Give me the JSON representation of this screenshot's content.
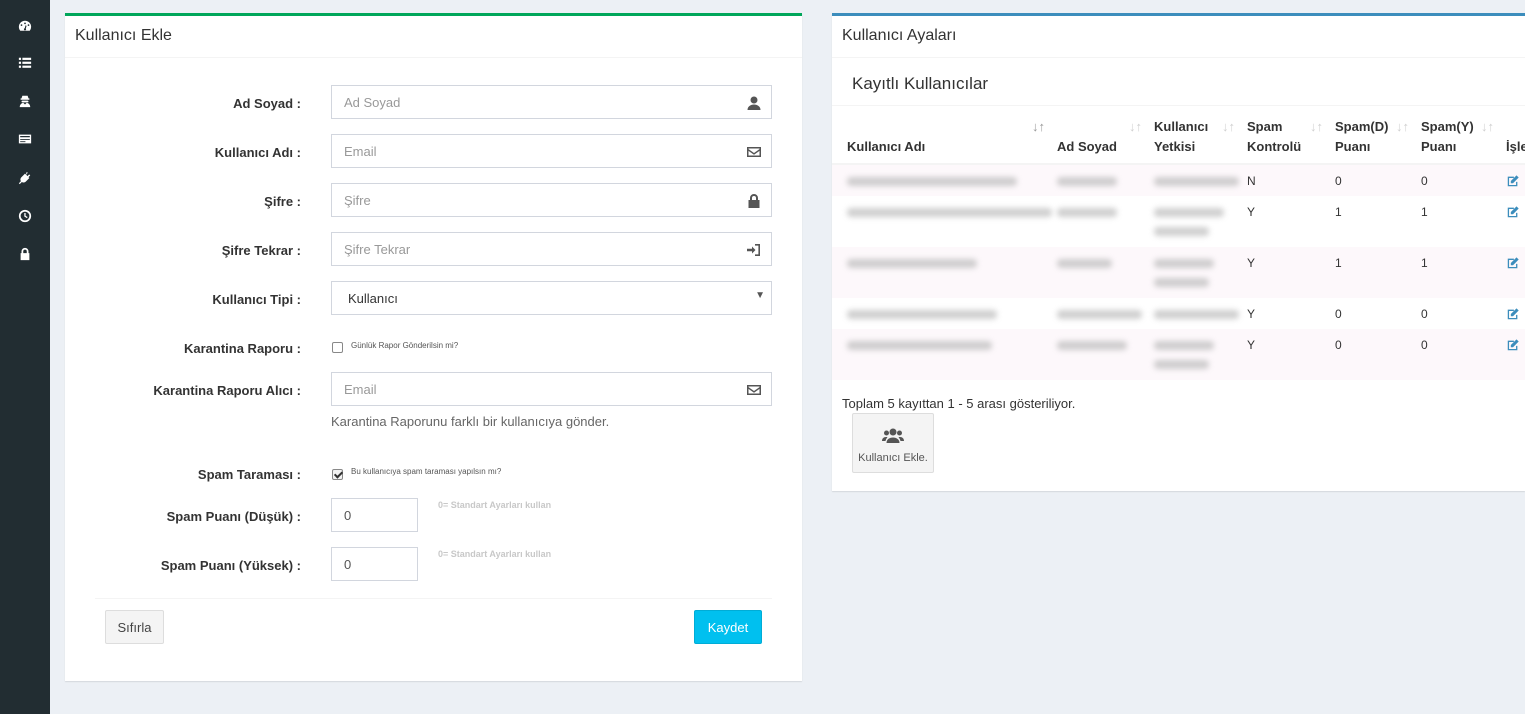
{
  "sidebar": {
    "icons": [
      "dashboard-icon",
      "list-icon",
      "user-secret-icon",
      "card-icon",
      "plug-icon",
      "clock-icon",
      "lock-icon"
    ]
  },
  "add_user": {
    "title": "Kullanıcı Ekle",
    "fields": {
      "name": {
        "label": "Ad Soyad :",
        "placeholder": "Ad Soyad",
        "icon": "user-icon"
      },
      "username": {
        "label": "Kullanıcı Adı :",
        "placeholder": "Email",
        "icon": "envelope-icon"
      },
      "password": {
        "label": "Şifre :",
        "placeholder": "Şifre",
        "icon": "lock-icon"
      },
      "password_repeat": {
        "label": "Şifre Tekrar :",
        "placeholder": "Şifre Tekrar",
        "icon": "sign-in-icon"
      },
      "user_type": {
        "label": "Kullanıcı Tipi :",
        "value": "Kullanıcı"
      },
      "quarantine_report": {
        "label": "Karantina Raporu :",
        "checkbox_label": "Günlük Rapor Gönderilsin mi?",
        "checked": false
      },
      "quarantine_recipient": {
        "label": "Karantina Raporu Alıcı :",
        "placeholder": "Email",
        "icon": "envelope-icon",
        "help": "Karantina Raporunu farklı bir kullanıcıya gönder."
      },
      "spam_scan": {
        "label": "Spam Taraması :",
        "checkbox_label": "Bu kullanıcıya spam taraması yapılsın mı?",
        "checked": true
      },
      "spam_low": {
        "label": "Spam Puanı (Düşük) :",
        "value": "0",
        "hint": "0= Standart Ayarları kullan"
      },
      "spam_high": {
        "label": "Spam Puanı (Yüksek) :",
        "value": "0",
        "hint": "0= Standart Ayarları kullan"
      }
    },
    "buttons": {
      "reset": "Sıfırla",
      "save": "Kaydet"
    }
  },
  "user_settings": {
    "title": "Kullanıcı Ayaları",
    "subtitle": "Kayıtlı Kullanıcılar",
    "columns": {
      "username": "Kullanıcı Adı",
      "fullname": "Ad Soyad",
      "permission_1": "Kullanıcı",
      "permission_2": "Yetkisi",
      "spam_1": "Spam",
      "spam_2": "Kontrolü",
      "spamd_1": "Spam(D)",
      "spamd_2": "Puanı",
      "spamy_1": "Spam(Y)",
      "spamy_2": "Puanı",
      "actions": "İşle"
    },
    "rows": [
      {
        "spam": "N",
        "low": "0",
        "high": "0"
      },
      {
        "spam": "Y",
        "low": "1",
        "high": "1"
      },
      {
        "spam": "Y",
        "low": "1",
        "high": "1"
      },
      {
        "spam": "Y",
        "low": "0",
        "high": "0"
      },
      {
        "spam": "Y",
        "low": "0",
        "high": "0"
      }
    ],
    "info": "Toplam 5 kayıttan 1 - 5 arası gösteriliyor.",
    "add_button": "Kullanıcı Ekle."
  }
}
